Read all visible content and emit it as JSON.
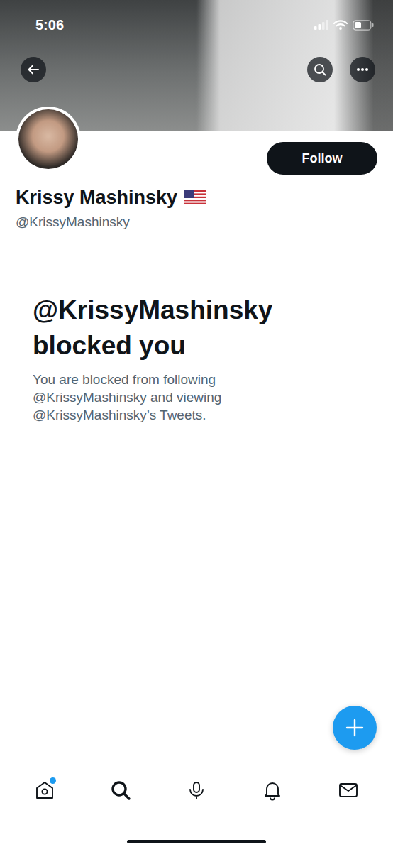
{
  "status_bar": {
    "time": "5:06"
  },
  "profile": {
    "name": "Krissy Mashinsky",
    "handle": "@KrissyMashinsky",
    "follow_button": "Follow"
  },
  "blocked": {
    "title": "@KrissyMashinsky blocked you",
    "message": "You are blocked from following @KrissyMashinsky and viewing @KrissyMashinsky’s Tweets."
  },
  "nav": {
    "items": [
      {
        "kind": "home",
        "selected": false,
        "badge": true
      },
      {
        "kind": "search",
        "selected": true,
        "badge": false
      },
      {
        "kind": "spaces",
        "selected": false,
        "badge": false
      },
      {
        "kind": "notifications",
        "selected": false,
        "badge": false
      },
      {
        "kind": "messages",
        "selected": false,
        "badge": false
      }
    ]
  }
}
